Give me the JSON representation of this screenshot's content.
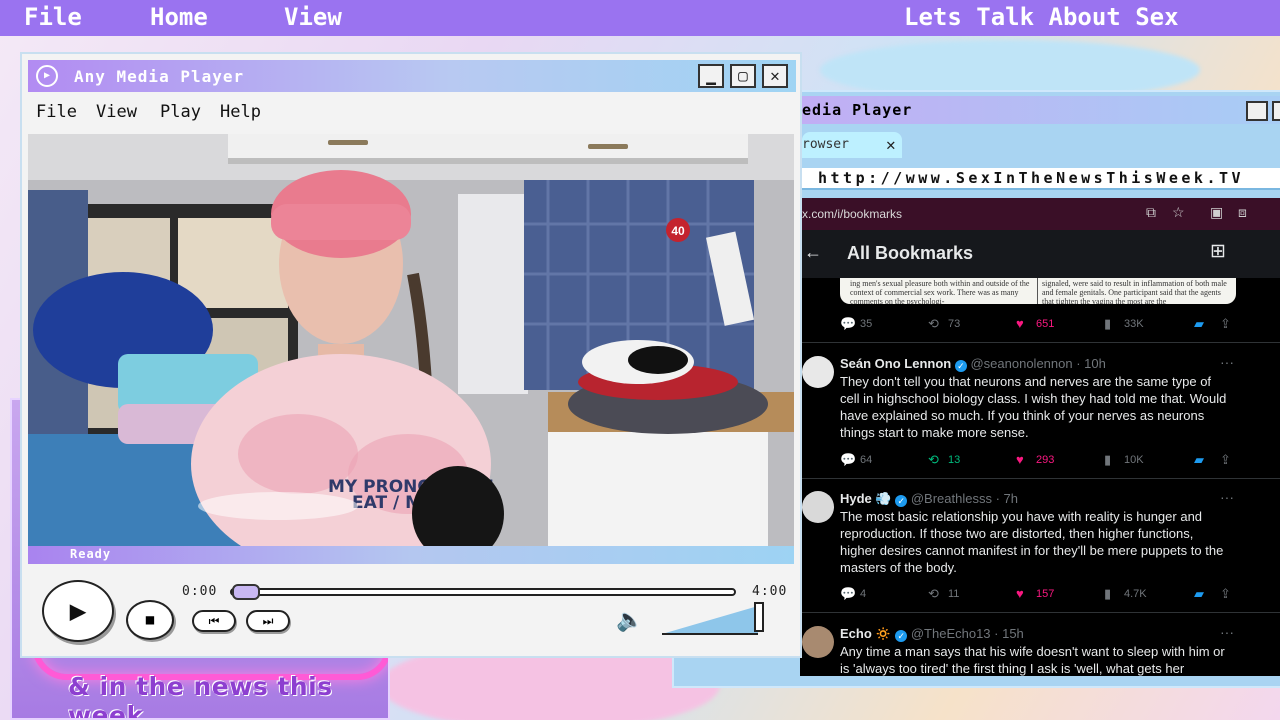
{
  "top_menu": {
    "file": "File",
    "home": "Home",
    "view": "View",
    "show_title": "Lets Talk About Sex"
  },
  "logo": {
    "tagline": "& in the news this week"
  },
  "back_window": {
    "title": "edia Player",
    "tab_label": "rowser",
    "tab_close": "✕",
    "url": "http://www.SexInTheNewsThisWeek.TV"
  },
  "twitter": {
    "address": "x.com/i/bookmarks",
    "header_title": "All Bookmarks",
    "back_icon": "←",
    "add_icon": "⊞",
    "image_text_left": "ing men's sexual pleasure both within and outside of the context of commercial sex work. There was as many comments on the psychologi-",
    "image_text_right": "signaled, were said to result in inflammation of both male and female genitals. One participant said that the agents that tighten the vagina the most are the",
    "first_actions": {
      "replies": "35",
      "reposts": "73",
      "likes": "651",
      "views": "33K"
    },
    "posts": [
      {
        "name": "Seán Ono Lennon",
        "handle": "@seanonolennon · 10h",
        "text": "They don't tell you that neurons and nerves are the same type of cell in highschool biology class. I wish they had told me that. Would have explained so much. If you think of your nerves as neurons things start to make more sense.",
        "replies": "64",
        "reposts": "13",
        "likes": "293",
        "views": "10K"
      },
      {
        "name": "Hyde 💨",
        "handle": "@Breathlesss · 7h",
        "text": "The most basic relationship you have with reality is hunger and reproduction. If those two are distorted, then higher functions, higher desires cannot manifest in for they'll be mere puppets to the masters of the body.",
        "replies": "4",
        "reposts": "11",
        "likes": "157",
        "views": "4.7K"
      },
      {
        "name": "Echo 🔅",
        "handle": "@TheEcho13 · 15h",
        "text": "Any time a man says that his wife doesn't want to sleep with him or is 'always too tired' the first thing I ask is 'well, what gets her"
      }
    ]
  },
  "player": {
    "title": "Any Media Player",
    "menu": {
      "file": "File",
      "view": "View",
      "play": "Play",
      "help": "Help"
    },
    "status": "Ready",
    "time_current": "0:00",
    "time_total": "4:00",
    "progress": 0.0,
    "volume": 1.0,
    "btn_minimize": "▁",
    "btn_maximize": "▢",
    "btn_close": "✕",
    "video_shirt_text_1": "MY PRONO   S ARE",
    "video_shirt_text_2": "EAT / MY",
    "video_calendar": "40"
  },
  "colors": {
    "topbar": "#9a73f0",
    "like": "#f91880",
    "repost_active": "#00ba7c",
    "bookmark": "#1d9bf0"
  }
}
